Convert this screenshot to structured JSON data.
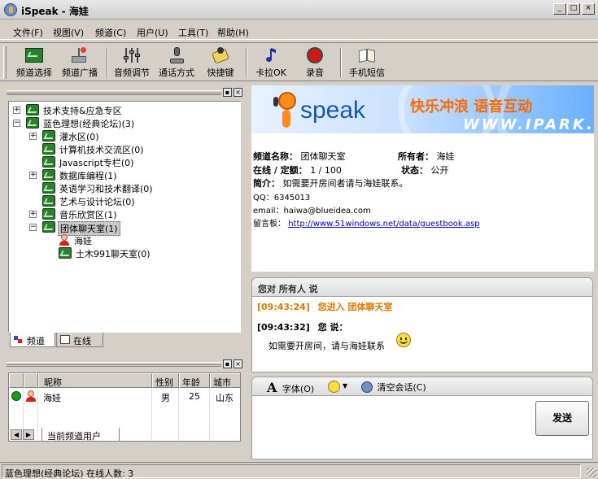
{
  "window": {
    "title": "iSpeak - 海娃",
    "min": "_",
    "max": "□",
    "close": "×"
  },
  "menu": [
    "文件(F)",
    "视图(V)",
    "频道(C)",
    "用户(U)",
    "工具(T)",
    "帮助(H)"
  ],
  "toolbar": [
    {
      "label": "频道选择",
      "icon": "channel-select-icon"
    },
    {
      "label": "频道广播",
      "icon": "broadcast-icon"
    },
    {
      "label": "音频调节",
      "icon": "audio-mixer-icon"
    },
    {
      "label": "通话方式",
      "icon": "call-mode-icon"
    },
    {
      "label": "快捷键",
      "icon": "hotkey-icon"
    },
    {
      "label": "卡拉OK",
      "icon": "karaoke-icon"
    },
    {
      "label": "录音",
      "icon": "record-icon"
    },
    {
      "label": "手机短信",
      "icon": "sms-icon"
    }
  ],
  "tree": [
    {
      "level": 0,
      "exp": "+",
      "text": "技术支持&应急专区",
      "kind": "channel"
    },
    {
      "level": 0,
      "exp": "−",
      "text": "蓝色理想(经典论坛)(3)",
      "kind": "channel"
    },
    {
      "level": 1,
      "exp": "+",
      "text": "灌水区(0)",
      "kind": "channel"
    },
    {
      "level": 1,
      "exp": "",
      "text": "计算机技术交流区(0)",
      "kind": "channel"
    },
    {
      "level": 1,
      "exp": "",
      "text": "Javascript专栏(0)",
      "kind": "channel"
    },
    {
      "level": 1,
      "exp": "+",
      "text": "数据库编程(1)",
      "kind": "channel"
    },
    {
      "level": 1,
      "exp": "",
      "text": "英语学习和技术翻译(0)",
      "kind": "channel"
    },
    {
      "level": 1,
      "exp": "",
      "text": "艺术与设计论坛(0)",
      "kind": "channel"
    },
    {
      "level": 1,
      "exp": "+",
      "text": "音乐欣赏区(1)",
      "kind": "channel"
    },
    {
      "level": 1,
      "exp": "−",
      "text": "团体聊天室(1)",
      "kind": "channel",
      "selected": true
    },
    {
      "level": 2,
      "exp": "",
      "text": "海娃",
      "kind": "user"
    },
    {
      "level": 2,
      "exp": "",
      "text": "土木991聊天室(0)",
      "kind": "channel"
    }
  ],
  "left_tabs": {
    "channel": "频道",
    "online": "在线"
  },
  "user_table": {
    "headers": [
      "昵称",
      "性别",
      "年龄",
      "城市"
    ],
    "rows": [
      {
        "nick": "海娃",
        "gender": "男",
        "age": "25",
        "city": "山东"
      }
    ],
    "tab_label": "当前频道用户"
  },
  "banner": {
    "brand": "speak",
    "slogan": "快乐冲浪  语音互动",
    "url_text": "WWW.IPARK."
  },
  "channel_info": {
    "name_label": "频道名称：",
    "name": "团体聊天室",
    "owner_label": "所有者：",
    "owner": "海娃",
    "online_label": "在线 / 定额：",
    "online": "1 / 100",
    "status_label": "状态：",
    "status": "公开",
    "intro_label": "简介：",
    "intro": "如需要开房间者请与海娃联系。",
    "qq": "QQ：6345013",
    "email": "email：haiwa@blueidea.com",
    "guestbook_label": "留言板：",
    "guestbook_url": "http://www.51windows.net/data/guestbook.asp"
  },
  "chat": {
    "header": "您对 所有人 说",
    "system_time": "[09:43:24]",
    "system_msg": "您进入 团体聊天室",
    "msg_time": "[09:43:32]",
    "msg_speaker": "您 说：",
    "msg_text": "如需要开房间，请与海娃联系"
  },
  "input_toolbar": {
    "font": "字体(O)",
    "clear": "清空会话(C)"
  },
  "send_label": "发送",
  "status_bar": "蓝色理想(经典论坛) 在线人数: 3",
  "colors": {
    "banner_orange": "#ff6a00",
    "system_msg": "#e07800",
    "link": "#0000cc",
    "channel_green": "#2e7d32"
  }
}
